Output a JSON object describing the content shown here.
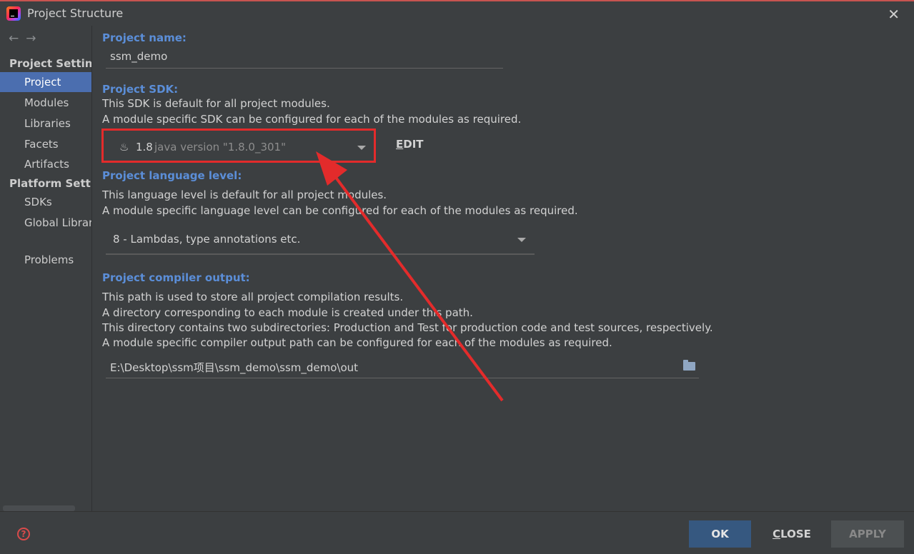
{
  "window": {
    "title": "Project Structure",
    "close_glyph": "✕"
  },
  "sidebar": {
    "nav_arrows": "←→",
    "project_settings_header": "Project Settings",
    "platform_settings_header": "Platform Settings",
    "items": [
      {
        "label": "Project",
        "selected": true
      },
      {
        "label": "Modules"
      },
      {
        "label": "Libraries"
      },
      {
        "label": "Facets"
      },
      {
        "label": "Artifacts"
      },
      {
        "label": "SDKs"
      },
      {
        "label": "Global Libraries"
      },
      {
        "label": "Problems"
      }
    ]
  },
  "project_name": {
    "label": "Project name:",
    "value": "ssm_demo"
  },
  "project_sdk": {
    "label": "Project SDK:",
    "desc1": "This SDK is default for all project modules.",
    "desc2": "A module specific SDK can be configured for each of the modules as required.",
    "version": "1.8",
    "version_desc": "java version \"1.8.0_301\"",
    "edit_first": "E",
    "edit_rest": "DIT"
  },
  "language_level": {
    "label": "Project language level:",
    "desc1": "This language level is default for all project modules.",
    "desc2": "A module specific language level can be configured for each of the modules as required.",
    "value": "8 - Lambdas, type annotations etc."
  },
  "compiler_output": {
    "label": "Project compiler output:",
    "desc1": "This path is used to store all project compilation results.",
    "desc2": "A directory corresponding to each module is created under this path.",
    "desc3": "This directory contains two subdirectories: Production and Test for production code and test sources, respectively.",
    "desc4": "A module specific compiler output path can be configured for each of the modules as required.",
    "path": "E:\\Desktop\\ssm项目\\ssm_demo\\ssm_demo\\out"
  },
  "buttons": {
    "ok": "OK",
    "close_first": "C",
    "close_rest": "LOSE",
    "apply": "APPLY",
    "help": "?"
  },
  "colors": {
    "accent": "#4b6eaf",
    "annotation_red": "#e32b2b",
    "label_blue": "#5b8ed8"
  }
}
